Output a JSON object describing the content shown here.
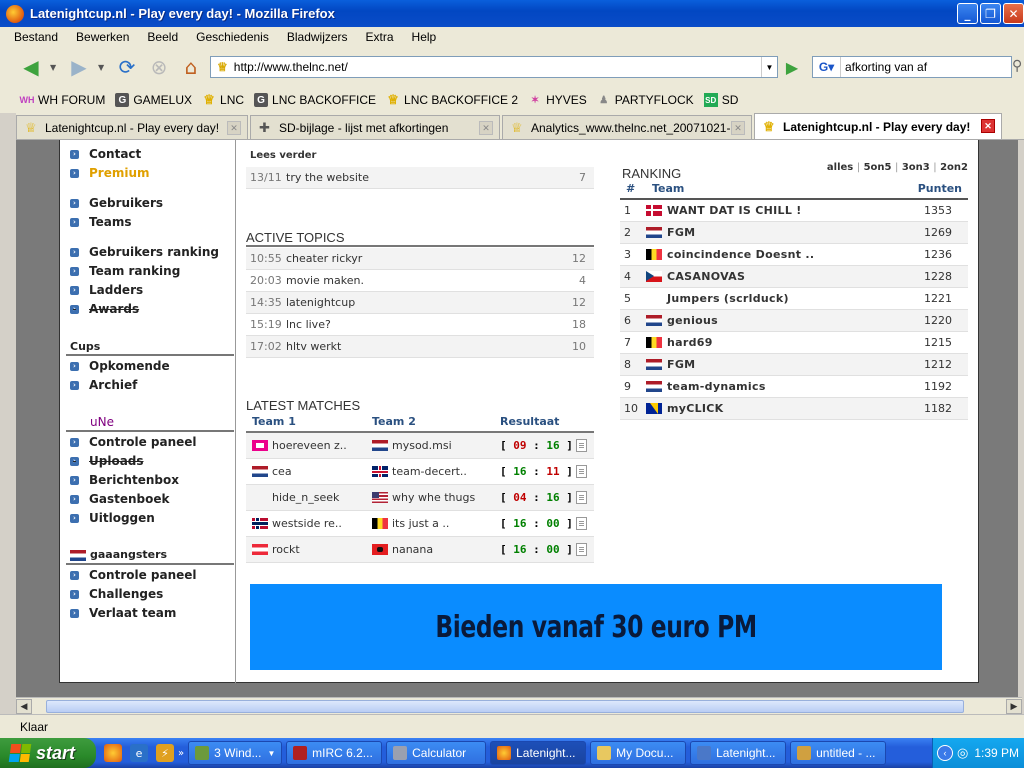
{
  "window": {
    "title": "Latenightcup.nl - Play every day! - Mozilla Firefox",
    "buttons": {
      "minimize": "_",
      "maximize": "❐",
      "close": "✕"
    }
  },
  "menu": [
    "Bestand",
    "Bewerken",
    "Beeld",
    "Geschiedenis",
    "Bladwijzers",
    "Extra",
    "Help"
  ],
  "nav": {
    "url": "http://www.thelnc.net/",
    "search_value": "afkorting van af"
  },
  "bookmarks": [
    {
      "label": "WH FORUM",
      "icon": "wh-icon"
    },
    {
      "label": "GAMELUX",
      "icon": "g-icon"
    },
    {
      "label": "LNC",
      "icon": "cup-icon"
    },
    {
      "label": "LNC BACKOFFICE",
      "icon": "g-icon"
    },
    {
      "label": "LNC BACKOFFICE 2",
      "icon": "cup-icon"
    },
    {
      "label": "HYVES",
      "icon": "hyves-icon"
    },
    {
      "label": "PARTYFLOCK",
      "icon": "partyflock-icon"
    },
    {
      "label": "SD",
      "icon": "sd-icon"
    }
  ],
  "tabs": [
    {
      "label": "Latenightcup.nl - Play every day!",
      "active": false
    },
    {
      "label": "SD-bijlage - lijst met afkortingen",
      "active": false
    },
    {
      "label": "Analytics_www.thelnc.net_20071021-...",
      "active": false
    },
    {
      "label": "Latenightcup.nl - Play every day!",
      "active": true
    }
  ],
  "sidebar": {
    "group1": [
      "Contact",
      "Premium"
    ],
    "group2": [
      "Gebruikers",
      "Teams"
    ],
    "group3": [
      "Gebruikers ranking",
      "Team ranking",
      "Ladders",
      "Awards"
    ],
    "cups_title": "Cups",
    "cups": [
      "Opkomende",
      "Archief"
    ],
    "une_title": "uNe",
    "une": [
      "Controle paneel",
      "Uploads",
      "Berichtenbox",
      "Gastenboek",
      "Uitloggen"
    ],
    "team_title": "gaaangsters",
    "team": [
      "Controle paneel",
      "Challenges",
      "Verlaat team"
    ]
  },
  "lees_verder": {
    "title": "Lees verder",
    "items": [
      {
        "time": "13/11",
        "subject": "try the website",
        "count": "7"
      }
    ]
  },
  "active_topics": {
    "title": "ACTIVE TOPICS",
    "items": [
      {
        "time": "10:55",
        "subject": "cheater rickyr",
        "count": "12"
      },
      {
        "time": "20:03",
        "subject": "movie maken.",
        "count": "4"
      },
      {
        "time": "14:35",
        "subject": "latenightcup",
        "count": "12"
      },
      {
        "time": "15:19",
        "subject": "lnc live?",
        "count": "18"
      },
      {
        "time": "17:02",
        "subject": "hltv werkt",
        "count": "10"
      }
    ]
  },
  "latest_matches": {
    "title": "LATEST MATCHES",
    "headers": {
      "team1": "Team 1",
      "team2": "Team 2",
      "result": "Resultaat"
    },
    "items": [
      {
        "team1": "hoereveen z..",
        "flag1": "my",
        "team2": "mysod.msi",
        "flag2": "nl",
        "score1": "09",
        "score2": "16"
      },
      {
        "team1": "cea",
        "flag1": "nl",
        "team2": "team-decert..",
        "flag2": "gb",
        "score1": "16",
        "score2": "11"
      },
      {
        "team1": "hide_n_seek",
        "flag1": "",
        "team2": "why whe thugs",
        "flag2": "us",
        "score1": "04",
        "score2": "16"
      },
      {
        "team1": "westside re..",
        "flag1": "no",
        "team2": "its just a ..",
        "flag2": "be",
        "score1": "16",
        "score2": "00"
      },
      {
        "team1": "rockt",
        "flag1": "at",
        "team2": "nanana",
        "flag2": "al",
        "score1": "16",
        "score2": "00"
      }
    ]
  },
  "banner": {
    "text": "Bieden vanaf 30 euro PM"
  },
  "ranking": {
    "title": "RANKING",
    "filters": [
      "alles",
      "5on5",
      "3on3",
      "2on2"
    ],
    "headers": {
      "pos": "#",
      "team": "Team",
      "points": "Punten"
    },
    "items": [
      {
        "pos": "1",
        "flag": "dk",
        "team": "WANT DAT IS CHILL !",
        "points": "1353"
      },
      {
        "pos": "2",
        "flag": "nl",
        "team": "FGM",
        "points": "1269"
      },
      {
        "pos": "3",
        "flag": "be",
        "team": "coincindence Doesnt ..",
        "points": "1236"
      },
      {
        "pos": "4",
        "flag": "cz",
        "team": "CASANOVAS",
        "points": "1228"
      },
      {
        "pos": "5",
        "flag": "",
        "team": "Jumpers (scrlduck)",
        "points": "1221"
      },
      {
        "pos": "6",
        "flag": "nl",
        "team": "genious",
        "points": "1220"
      },
      {
        "pos": "7",
        "flag": "be",
        "team": "hard69",
        "points": "1215"
      },
      {
        "pos": "8",
        "flag": "nl",
        "team": "FGM",
        "points": "1212"
      },
      {
        "pos": "9",
        "flag": "nl",
        "team": "team-dynamics",
        "points": "1192"
      },
      {
        "pos": "10",
        "flag": "ba",
        "team": "myCLICK",
        "points": "1182"
      }
    ]
  },
  "status": {
    "text": "Klaar"
  },
  "taskbar": {
    "start": "start",
    "items": [
      {
        "label": "3 Wind...",
        "active": false
      },
      {
        "label": "mIRC 6.2...",
        "active": false
      },
      {
        "label": "Calculator",
        "active": false
      },
      {
        "label": "Latenight...",
        "active": true
      },
      {
        "label": "My Docu...",
        "active": false
      },
      {
        "label": "Latenight...",
        "active": false
      },
      {
        "label": "untitled - ...",
        "active": false
      }
    ],
    "clock": "1:39 PM"
  }
}
